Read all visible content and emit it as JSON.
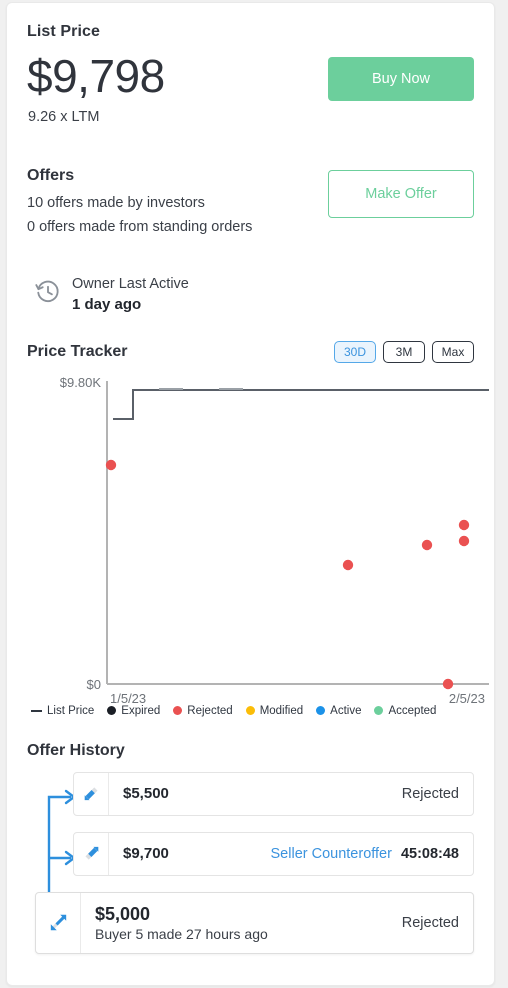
{
  "list_price": {
    "label": "List Price",
    "amount": "$9,798",
    "multiple": "9.26 x LTM",
    "buy_button": "Buy Now"
  },
  "offers": {
    "label": "Offers",
    "investor_line": "10 offers made by investors",
    "standing_line": "0 offers made from standing orders",
    "make_offer_button": "Make Offer"
  },
  "owner_activity": {
    "label": "Owner Last Active",
    "value": "1 day ago",
    "icon": "history-clock-icon"
  },
  "price_tracker": {
    "title": "Price Tracker",
    "ranges": [
      {
        "label": "30D",
        "active": true
      },
      {
        "label": "3M",
        "active": false
      },
      {
        "label": "Max",
        "active": false
      }
    ],
    "legend": [
      {
        "label": "List Price",
        "type": "line",
        "color": "#2f3640"
      },
      {
        "label": "Expired",
        "type": "dot",
        "color": "#1b1f26"
      },
      {
        "label": "Rejected",
        "type": "dot",
        "color": "#ea5151"
      },
      {
        "label": "Modified",
        "type": "dot",
        "color": "#fbbd08"
      },
      {
        "label": "Active",
        "type": "dot",
        "color": "#1c92e8"
      },
      {
        "label": "Accepted",
        "type": "dot",
        "color": "#6ccf9c"
      }
    ]
  },
  "chart_data": {
    "type": "scatter",
    "title": "Price Tracker",
    "xlabel": "",
    "ylabel": "",
    "x_ticks": [
      "1/5/23",
      "2/5/23"
    ],
    "y_ticks": [
      "$0",
      "$9.80K"
    ],
    "ylim": [
      0,
      9800
    ],
    "xlim": [
      "1/5/23",
      "2/5/23"
    ],
    "grid": false,
    "legend_position": "bottom",
    "series": [
      {
        "name": "List Price",
        "type": "step-line",
        "color": "#5a6068",
        "points": [
          {
            "x": "1/5/23",
            "y": 9450
          },
          {
            "x": "1/6/23",
            "y": 9450
          },
          {
            "x": "1/6/23",
            "y": 9798
          },
          {
            "x": "2/5/23",
            "y": 9798
          }
        ]
      },
      {
        "name": "Rejected",
        "type": "scatter",
        "color": "#ea5151",
        "points": [
          {
            "x": "1/5/23",
            "y": 7300,
            "label": "offer on axis"
          },
          {
            "x": "1/27/23",
            "y": 4050
          },
          {
            "x": "2/1/23",
            "y": 4700
          },
          {
            "x": "2/4/23",
            "y": 5350
          },
          {
            "x": "2/4/23",
            "y": 4850
          },
          {
            "x": "2/5/23",
            "y": 0
          }
        ]
      }
    ]
  },
  "offer_history": {
    "title": "Offer History",
    "rows": [
      {
        "icon": "offer-arrow-down-icon",
        "amount": "$5,500",
        "status": "Rejected",
        "counteroffer_label": null,
        "timer": null,
        "sub": null,
        "primary": false
      },
      {
        "icon": "offer-arrow-up-icon",
        "amount": "$9,700",
        "status": null,
        "counteroffer_label": "Seller Counteroffer",
        "timer": "45:08:48",
        "sub": null,
        "primary": false
      },
      {
        "icon": "offer-arrow-both-icon",
        "amount": "$5,000",
        "status": "Rejected",
        "counteroffer_label": null,
        "timer": null,
        "sub": "Buyer 5 made 27 hours ago",
        "primary": true
      }
    ]
  }
}
